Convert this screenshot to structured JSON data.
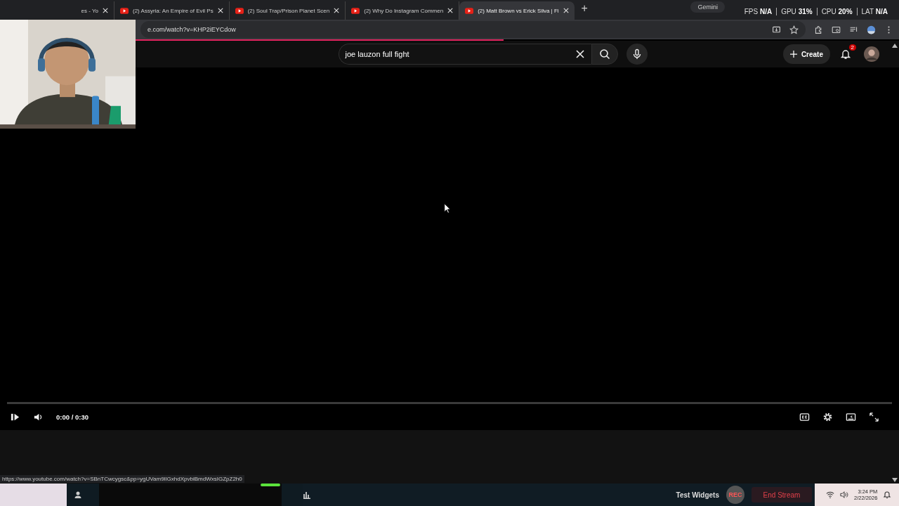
{
  "browser": {
    "tabs": [
      {
        "title": "es - Yo",
        "selected": false
      },
      {
        "title": "(2) Assyria: An Empire of Evil Ps",
        "selected": false
      },
      {
        "title": "(2) Soul Trap/Prison Planet Scen",
        "selected": false
      },
      {
        "title": "(2) Why Do Instagram Commen",
        "selected": false
      },
      {
        "title": "(2) Matt Brown vs Erick Silva | Fi",
        "selected": true
      }
    ],
    "new_tab": "+",
    "url": "e.com/watch?v=KHP2iEYCdow",
    "page_load": {
      "level": 0.56
    },
    "gemini": "Gemini"
  },
  "stats": [
    {
      "label": "FPS",
      "value": "N/A"
    },
    {
      "label": "GPU",
      "value": "31%"
    },
    {
      "label": "CPU",
      "value": "20%"
    },
    {
      "label": "LAT",
      "value": "N/A"
    }
  ],
  "youtube": {
    "search": {
      "value": "joe lauzon full fight"
    },
    "create": "Create",
    "notifications": "2"
  },
  "player": {
    "time": "0:00 / 0:30",
    "progress": {
      "level": 0
    }
  },
  "status_url": "https://www.youtube.com/watch?v=SBnTCwcygsc&pp=ygUVam9lIGxhdXpvbiBmdWxsIGZpZ2h0",
  "taskbar": {
    "test_widgets": "Test Widgets",
    "rec": "REC",
    "end_stream": "End Stream",
    "time": "3:24 PM",
    "date": "2/22/2026"
  }
}
